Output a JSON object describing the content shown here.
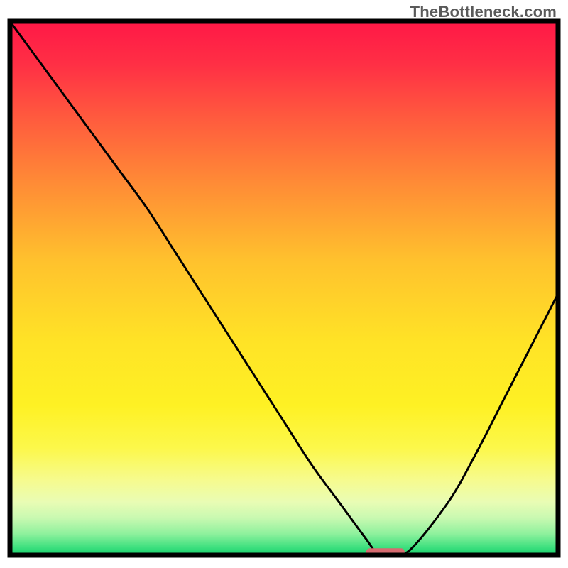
{
  "watermark": "TheBottleneck.com",
  "chart_data": {
    "type": "line",
    "title": "",
    "xlabel": "",
    "ylabel": "",
    "xlim": [
      0,
      100
    ],
    "ylim": [
      0,
      100
    ],
    "x": [
      0,
      5,
      10,
      15,
      20,
      25,
      30,
      35,
      40,
      45,
      50,
      55,
      60,
      65,
      67,
      70,
      73,
      80,
      85,
      90,
      95,
      100
    ],
    "y": [
      100,
      93,
      86,
      79,
      72,
      65,
      57,
      49,
      41,
      33,
      25,
      17,
      10,
      3,
      0.5,
      0.5,
      1,
      10,
      19,
      29,
      39,
      49
    ],
    "optimal_marker": {
      "x_start": 65,
      "x_end": 72,
      "y": 0.5
    },
    "gradient_stops": [
      {
        "offset": 0.0,
        "color": "#ff1846"
      },
      {
        "offset": 0.08,
        "color": "#ff2f45"
      },
      {
        "offset": 0.18,
        "color": "#ff5a3e"
      },
      {
        "offset": 0.3,
        "color": "#ff8a36"
      },
      {
        "offset": 0.45,
        "color": "#ffc22d"
      },
      {
        "offset": 0.6,
        "color": "#ffe326"
      },
      {
        "offset": 0.72,
        "color": "#fef124"
      },
      {
        "offset": 0.8,
        "color": "#fcf84b"
      },
      {
        "offset": 0.86,
        "color": "#f6fb8f"
      },
      {
        "offset": 0.9,
        "color": "#e9fcb4"
      },
      {
        "offset": 0.93,
        "color": "#c9f9b1"
      },
      {
        "offset": 0.96,
        "color": "#8ef19d"
      },
      {
        "offset": 0.985,
        "color": "#3fe07f"
      },
      {
        "offset": 1.0,
        "color": "#13cf6a"
      }
    ],
    "marker_color": "#d66b70",
    "curve_color": "#000000",
    "frame_color": "#000000"
  },
  "plot": {
    "outer_size": 800,
    "margin_top": 30,
    "margin_right": 14,
    "margin_bottom": 18,
    "margin_left": 14,
    "stroke_width_frame": 7,
    "stroke_width_curve": 3
  }
}
